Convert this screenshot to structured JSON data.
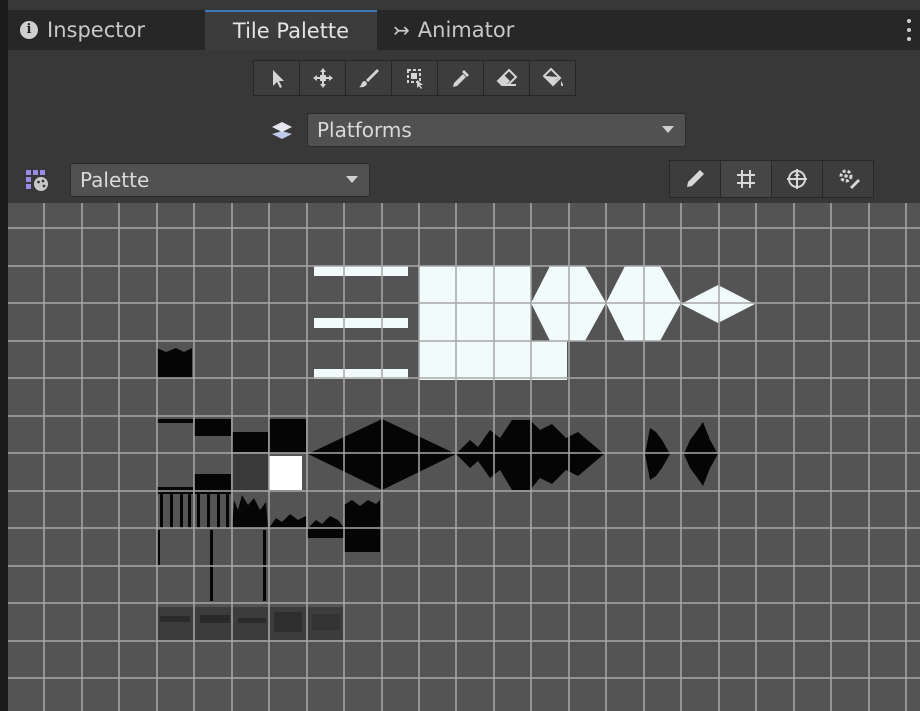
{
  "tabs": {
    "inspector": "Inspector",
    "tile_palette": "Tile Palette",
    "animator": "Animator",
    "active": "Tile Palette"
  },
  "tools": [
    {
      "icon": "select-arrow-icon"
    },
    {
      "icon": "move-icon"
    },
    {
      "icon": "paint-brush-icon"
    },
    {
      "icon": "box-fill-icon"
    },
    {
      "icon": "picker-eyedropper-icon"
    },
    {
      "icon": "eraser-icon"
    },
    {
      "icon": "flood-fill-bucket-icon"
    }
  ],
  "active_tilemap": {
    "icon": "layers-icon",
    "value": "Platforms"
  },
  "palette": {
    "icon": "palette-icon",
    "value": "Palette"
  },
  "palette_tools": [
    {
      "icon": "edit-pencil-icon",
      "active": false
    },
    {
      "icon": "grid-icon",
      "active": true
    },
    {
      "icon": "gizmos-icon",
      "active": false
    },
    {
      "icon": "settings-gear-icon",
      "active": false
    }
  ],
  "colors": {
    "accent": "#3a79bb",
    "canvas": "#545454",
    "grid_line": "#a8a8a8",
    "tile_light": "#f2fbfb",
    "tile_dark": "#050505"
  }
}
